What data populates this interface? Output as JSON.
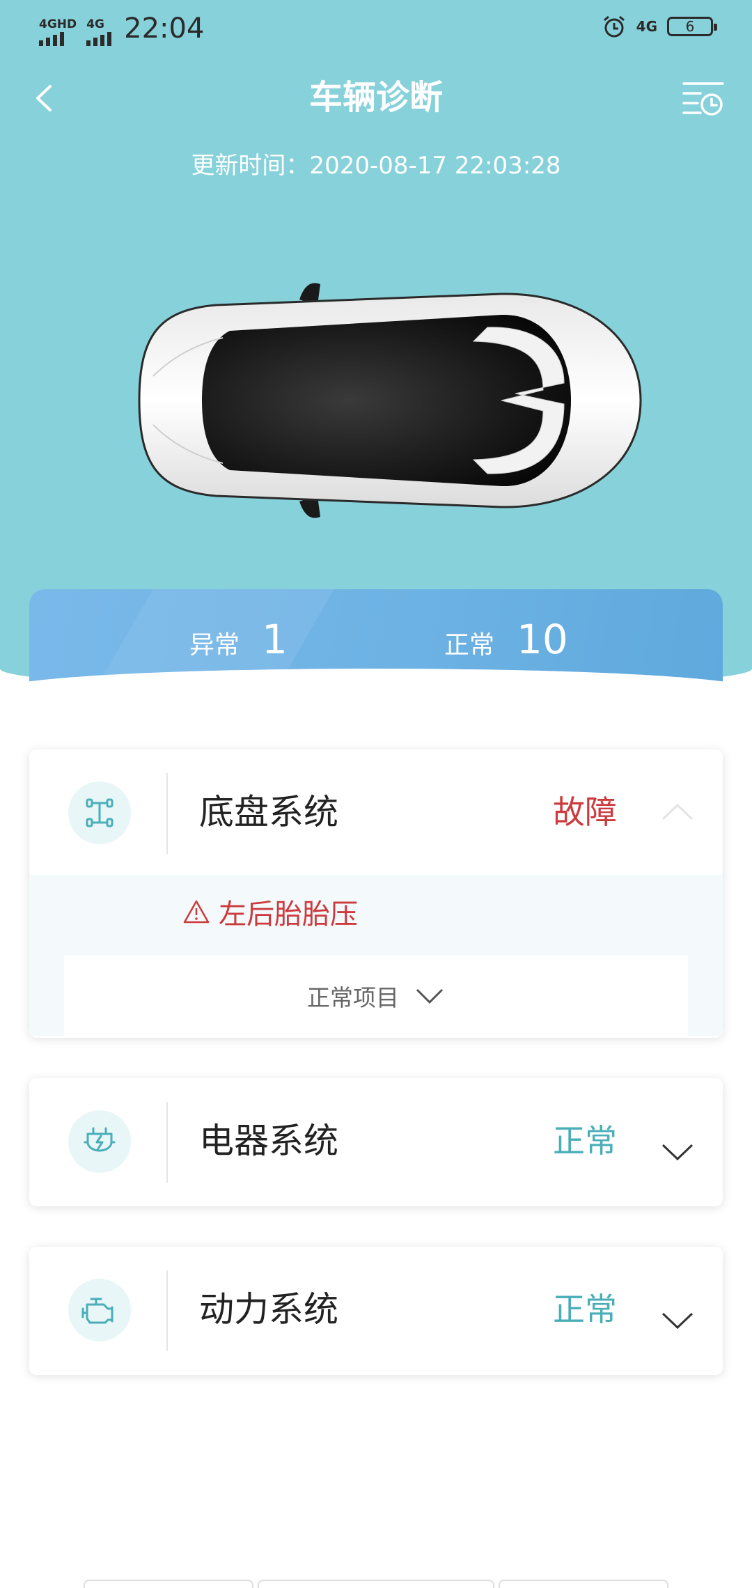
{
  "status_bar": {
    "network1": "4GHD",
    "network2": "4G",
    "time": "22:04",
    "network_right": "4G",
    "battery": "6"
  },
  "header": {
    "title": "车辆诊断",
    "update_time": "更新时间：2020-08-17 22:03:28"
  },
  "summary": {
    "abnormal_label": "异常",
    "abnormal_count": "1",
    "normal_label": "正常",
    "normal_count": "10"
  },
  "systems": [
    {
      "name": "底盘系统",
      "status": "故障",
      "expanded": true,
      "icon": "chassis-icon",
      "faults": [
        "左后胎胎压"
      ],
      "normal_items_label": "正常项目"
    },
    {
      "name": "电器系统",
      "status": "正常",
      "expanded": false,
      "icon": "electrical-plug-icon"
    },
    {
      "name": "动力系统",
      "status": "正常",
      "expanded": false,
      "icon": "engine-icon"
    }
  ],
  "colors": {
    "header_bg": "#87d1da",
    "fault": "#cc3a3e",
    "normal": "#4aaeb9",
    "summary_bar": "#6db2e4"
  }
}
